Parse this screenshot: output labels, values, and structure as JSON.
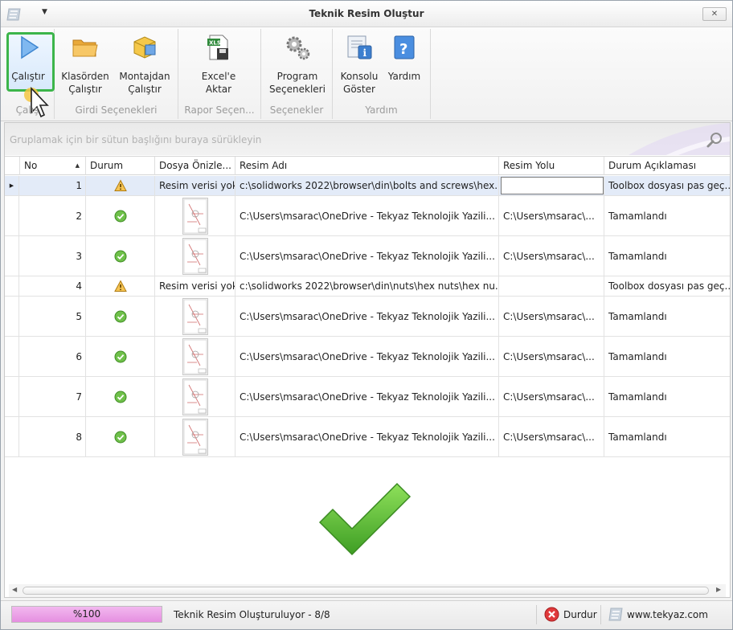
{
  "window": {
    "title": "Teknik Resim Oluştur"
  },
  "ribbon": {
    "groups": [
      {
        "label": "Çalış"
      },
      {
        "label": "Girdi Seçenekleri"
      },
      {
        "label": "Rapor Seçen..."
      },
      {
        "label": "Seçenekler"
      },
      {
        "label": "Yardım"
      }
    ],
    "buttons": {
      "run": "Çalıştır",
      "run_folder_1": "Klasörden",
      "run_folder_2": "Çalıştır",
      "run_assembly_1": "Montajdan",
      "run_assembly_2": "Çalıştır",
      "export_excel_1": "Excel'e",
      "export_excel_2": "Aktar",
      "program_options_1": "Program",
      "program_options_2": "Seçenekleri",
      "console_1": "Konsolu",
      "console_2": "Göster",
      "help": "Yardım"
    }
  },
  "grid": {
    "group_placeholder": "Gruplamak için bir sütun başlığını buraya sürükleyin",
    "columns": [
      "No",
      "Durum",
      "Dosya Önizle...",
      "Resim Adı",
      "Resim Yolu",
      "Durum Açıklaması"
    ],
    "rows": [
      {
        "no": "1",
        "status": "warning",
        "preview": "Resim verisi yok",
        "name": "c:\\solidworks 2022\\browser\\din\\bolts and screws\\hex...",
        "path": "",
        "desc": "Toolbox dosyası pas geç..."
      },
      {
        "no": "2",
        "status": "ok",
        "preview": "",
        "name": "C:\\Users\\msarac\\OneDrive - Tekyaz Teknolojik Yazili...",
        "path": "C:\\Users\\msarac\\...",
        "desc": "Tamamlandı"
      },
      {
        "no": "3",
        "status": "ok",
        "preview": "",
        "name": "C:\\Users\\msarac\\OneDrive - Tekyaz Teknolojik Yazili...",
        "path": "C:\\Users\\msarac\\...",
        "desc": "Tamamlandı"
      },
      {
        "no": "4",
        "status": "warning",
        "preview": "Resim verisi yok",
        "name": "c:\\solidworks 2022\\browser\\din\\nuts\\hex nuts\\hex nu...",
        "path": "",
        "desc": "Toolbox dosyası pas geç..."
      },
      {
        "no": "5",
        "status": "ok",
        "preview": "",
        "name": "C:\\Users\\msarac\\OneDrive - Tekyaz Teknolojik Yazili...",
        "path": "C:\\Users\\msarac\\...",
        "desc": "Tamamlandı"
      },
      {
        "no": "6",
        "status": "ok",
        "preview": "",
        "name": "C:\\Users\\msarac\\OneDrive - Tekyaz Teknolojik Yazili...",
        "path": "C:\\Users\\msarac\\...",
        "desc": "Tamamlandı"
      },
      {
        "no": "7",
        "status": "ok",
        "preview": "",
        "name": "C:\\Users\\msarac\\OneDrive - Tekyaz Teknolojik Yazili...",
        "path": "C:\\Users\\msarac\\...",
        "desc": "Tamamlandı"
      },
      {
        "no": "8",
        "status": "ok",
        "preview": "",
        "name": "C:\\Users\\msarac\\OneDrive - Tekyaz Teknolojik Yazili...",
        "path": "C:\\Users\\msarac\\...",
        "desc": "Tamamlandı"
      }
    ]
  },
  "status": {
    "progress_label": "%100",
    "progress_value": 1.0,
    "message": "Teknik Resim Oluşturuluyor - 8/8",
    "stop_label": "Durdur",
    "website": "www.tekyaz.com"
  },
  "colors": {
    "accent_green": "#3cb54a",
    "progress": "#e58fe0",
    "selected_row": "#e3ebf8"
  }
}
